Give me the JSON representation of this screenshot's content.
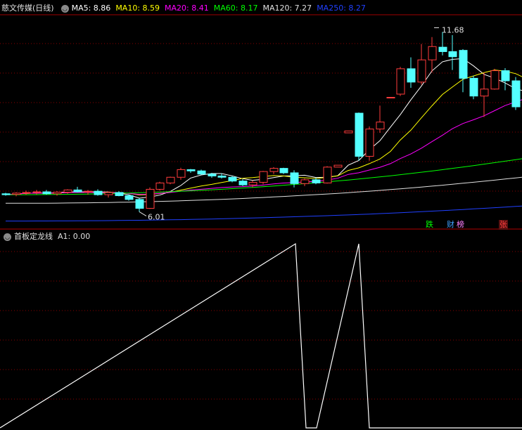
{
  "main_header": {
    "title": "慈文传媒(日线)",
    "ma": [
      {
        "label": "MA5: 8.86",
        "color": "#ffffff"
      },
      {
        "label": "MA10: 8.59",
        "color": "#ffff00"
      },
      {
        "label": "MA20: 8.41",
        "color": "#ff00ff"
      },
      {
        "label": "MA60: 8.17",
        "color": "#00ff00"
      },
      {
        "label": "MA120: 7.27",
        "color": "#e0e0e0"
      },
      {
        "label": "MA250: 8.27",
        "color": "#2040ff"
      }
    ]
  },
  "sub_header": {
    "title": "首板定龙线",
    "value": "A1: 0.00"
  },
  "tags": [
    {
      "text": "跌",
      "color": "#00ff00"
    },
    {
      "text": "财",
      "color": "#40a0ff"
    },
    {
      "text": "榜",
      "color": "#ff80ff"
    },
    {
      "text": "张",
      "color": "#ff4040"
    }
  ],
  "chart_data": [
    {
      "type": "candlestick",
      "high_label": "11.68",
      "low_label": "6.01",
      "ylim": [
        5.6,
        12.2
      ],
      "colors": {
        "up": "#ff3c3c",
        "down": "#54ffff",
        "grid": "#8b0000"
      },
      "candles": [
        [
          6.58,
          6.61,
          6.52,
          6.55
        ],
        [
          6.56,
          6.63,
          6.5,
          6.6
        ],
        [
          6.6,
          6.68,
          6.55,
          6.62
        ],
        [
          6.62,
          6.7,
          6.56,
          6.64
        ],
        [
          6.64,
          6.7,
          6.55,
          6.58
        ],
        [
          6.58,
          6.66,
          6.52,
          6.63
        ],
        [
          6.63,
          6.72,
          6.58,
          6.7
        ],
        [
          6.7,
          6.8,
          6.62,
          6.64
        ],
        [
          6.64,
          6.7,
          6.55,
          6.66
        ],
        [
          6.66,
          6.72,
          6.52,
          6.55
        ],
        [
          6.55,
          6.65,
          6.46,
          6.62
        ],
        [
          6.62,
          6.66,
          6.5,
          6.52
        ],
        [
          6.52,
          6.56,
          6.36,
          6.4
        ],
        [
          6.4,
          6.44,
          6.01,
          6.12
        ],
        [
          6.12,
          6.78,
          6.1,
          6.72
        ],
        [
          6.72,
          6.96,
          6.68,
          6.92
        ],
        [
          6.92,
          7.12,
          6.88,
          7.1
        ],
        [
          7.1,
          7.4,
          7.02,
          7.34
        ],
        [
          7.34,
          7.36,
          7.24,
          7.3
        ],
        [
          7.3,
          7.34,
          7.18,
          7.2
        ],
        [
          7.2,
          7.24,
          7.08,
          7.14
        ],
        [
          7.14,
          7.22,
          7.06,
          7.1
        ],
        [
          7.1,
          7.14,
          6.94,
          6.98
        ],
        [
          6.98,
          7.04,
          6.82,
          6.86
        ],
        [
          6.86,
          7.0,
          6.78,
          6.94
        ],
        [
          6.94,
          7.3,
          6.88,
          7.28
        ],
        [
          7.28,
          7.42,
          7.2,
          7.38
        ],
        [
          7.38,
          7.4,
          7.2,
          7.24
        ],
        [
          7.24,
          7.32,
          6.78,
          6.9
        ],
        [
          6.9,
          7.06,
          6.82,
          7.02
        ],
        [
          7.02,
          7.08,
          6.88,
          6.92
        ],
        [
          6.92,
          7.45,
          6.9,
          7.42
        ],
        [
          7.42,
          7.48,
          7.42,
          7.48
        ],
        [
          8.5,
          8.56,
          8.5,
          8.56
        ],
        [
          9.12,
          9.14,
          7.62,
          7.76
        ],
        [
          7.76,
          8.7,
          7.62,
          8.62
        ],
        [
          8.62,
          9.36,
          8.5,
          8.84
        ],
        [
          9.6,
          9.62,
          9.6,
          9.62
        ],
        [
          9.72,
          10.58,
          9.66,
          10.52
        ],
        [
          10.52,
          10.88,
          9.92,
          10.1
        ],
        [
          10.1,
          11.3,
          10.02,
          10.8
        ],
        [
          10.8,
          11.52,
          10.4,
          11.22
        ],
        [
          11.2,
          11.68,
          10.94,
          11.06
        ],
        [
          11.06,
          11.58,
          10.48,
          10.9
        ],
        [
          11.1,
          11.14,
          9.78,
          10.22
        ],
        [
          10.22,
          10.3,
          9.56,
          9.66
        ],
        [
          9.66,
          10.4,
          9.0,
          9.88
        ],
        [
          9.88,
          10.52,
          9.86,
          10.46
        ],
        [
          10.46,
          10.54,
          9.84,
          10.14
        ],
        [
          10.14,
          10.26,
          9.22,
          9.32
        ],
        [
          9.32,
          9.42,
          9.14,
          9.2
        ],
        [
          9.04,
          9.08,
          8.34,
          8.48
        ],
        [
          8.34,
          8.42,
          8.3,
          8.36
        ],
        [
          8.5,
          9.32,
          8.44,
          9.26
        ],
        [
          9.62,
          9.7,
          9.14,
          9.24
        ]
      ],
      "x_positions": [
        8,
        23,
        37,
        52,
        66,
        81,
        96,
        110,
        125,
        139,
        154,
        169,
        183,
        198,
        213,
        227,
        242,
        257,
        271,
        286,
        301,
        315,
        330,
        345,
        359,
        374,
        389,
        403,
        418,
        433,
        449,
        465,
        480,
        495,
        510,
        525,
        540,
        555,
        569,
        584,
        599,
        614,
        629,
        643,
        658,
        673,
        688,
        703,
        718,
        733,
        748,
        763,
        778,
        792,
        807
      ]
    },
    {
      "type": "line",
      "name": "A1",
      "values": [
        0,
        1,
        0,
        0,
        1,
        0,
        0
      ],
      "x_positions": [
        0,
        420,
        435,
        450,
        510,
        525,
        540
      ],
      "ylim": [
        0,
        1
      ]
    }
  ]
}
